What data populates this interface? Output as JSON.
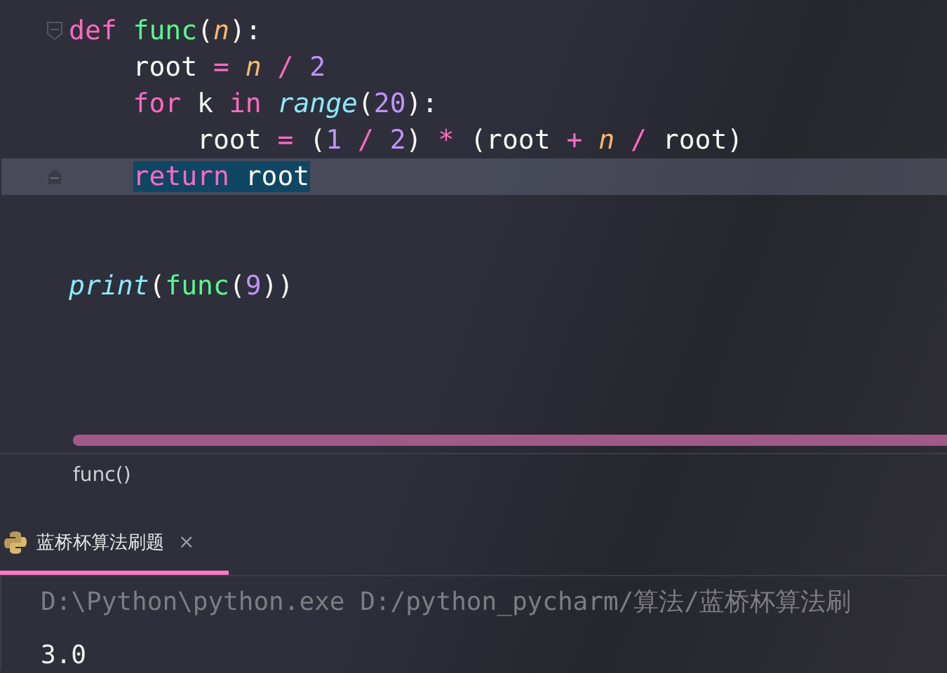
{
  "editor": {
    "lines": [
      {
        "kind": "code",
        "fold_start": true,
        "fold_end": false,
        "current": false,
        "tokens": [
          {
            "kind": "keyword",
            "text": "def"
          },
          {
            "kind": "function",
            "text": " func"
          },
          {
            "kind": "plain",
            "text": "("
          },
          {
            "kind": "param",
            "text": "n"
          },
          {
            "kind": "plain",
            "text": "):"
          }
        ]
      },
      {
        "kind": "code",
        "fold_start": false,
        "fold_end": false,
        "current": false,
        "tokens": [
          {
            "kind": "plain",
            "text": "    root"
          },
          {
            "kind": "operator",
            "text": " ="
          },
          {
            "kind": "param",
            "text": " n"
          },
          {
            "kind": "operator",
            "text": " /"
          },
          {
            "kind": "number",
            "text": " 2"
          }
        ]
      },
      {
        "kind": "code",
        "fold_start": false,
        "fold_end": false,
        "current": false,
        "tokens": [
          {
            "kind": "keyword",
            "text": "    for"
          },
          {
            "kind": "plain",
            "text": " k"
          },
          {
            "kind": "keyword",
            "text": " in"
          },
          {
            "kind": "builtin",
            "text": " range"
          },
          {
            "kind": "plain",
            "text": "("
          },
          {
            "kind": "number",
            "text": "20"
          },
          {
            "kind": "plain",
            "text": "):"
          }
        ]
      },
      {
        "kind": "code",
        "fold_start": false,
        "fold_end": false,
        "current": false,
        "tokens": [
          {
            "kind": "plain",
            "text": "        root"
          },
          {
            "kind": "operator",
            "text": " ="
          },
          {
            "kind": "plain",
            "text": " ("
          },
          {
            "kind": "number",
            "text": "1"
          },
          {
            "kind": "operator",
            "text": " /"
          },
          {
            "kind": "number",
            "text": " 2"
          },
          {
            "kind": "plain",
            "text": ")"
          },
          {
            "kind": "operator",
            "text": " *"
          },
          {
            "kind": "plain",
            "text": " (root"
          },
          {
            "kind": "operator",
            "text": " +"
          },
          {
            "kind": "param",
            "text": " n"
          },
          {
            "kind": "operator",
            "text": " /"
          },
          {
            "kind": "plain",
            "text": " root)"
          }
        ]
      },
      {
        "kind": "code",
        "fold_start": false,
        "fold_end": true,
        "current": true,
        "tokens": [
          {
            "kind": "keyword",
            "text": "    return"
          },
          {
            "kind": "plain",
            "text": " root"
          }
        ]
      },
      {
        "kind": "blank"
      },
      {
        "kind": "blank"
      },
      {
        "kind": "code",
        "fold_start": false,
        "fold_end": false,
        "current": false,
        "tokens": [
          {
            "kind": "builtin",
            "text": "print"
          },
          {
            "kind": "plain",
            "text": "("
          },
          {
            "kind": "function",
            "text": "func"
          },
          {
            "kind": "plain",
            "text": "("
          },
          {
            "kind": "number",
            "text": "9"
          },
          {
            "kind": "plain",
            "text": "))"
          }
        ]
      }
    ]
  },
  "breadcrumb": "func()",
  "run_tabs": [
    {
      "label": "蓝桥杯算法刷题",
      "selected": true,
      "close": "×"
    }
  ],
  "console": [
    {
      "kind": "command",
      "text": "D:\\Python\\python.exe D:/python_pycharm/算法/蓝桥杯算法刷"
    },
    {
      "kind": "output",
      "text": "3.0"
    }
  ]
}
